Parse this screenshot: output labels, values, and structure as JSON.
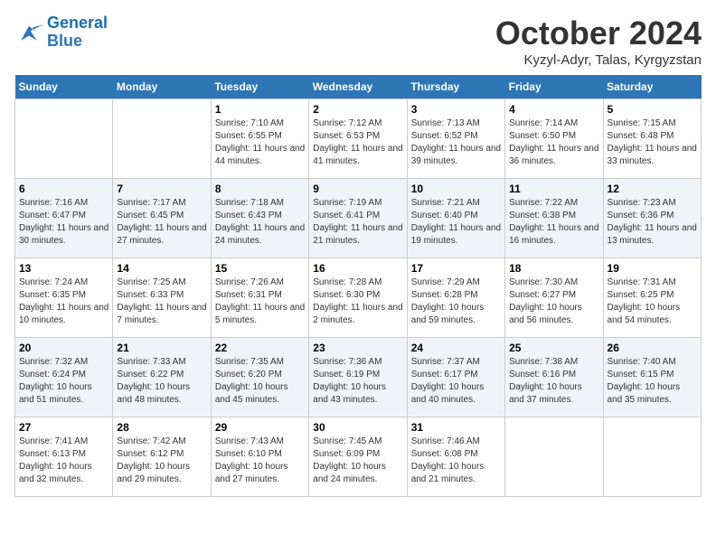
{
  "logo": {
    "line1": "General",
    "line2": "Blue"
  },
  "title": "October 2024",
  "subtitle": "Kyzyl-Adyr, Talas, Kyrgyzstan",
  "weekdays": [
    "Sunday",
    "Monday",
    "Tuesday",
    "Wednesday",
    "Thursday",
    "Friday",
    "Saturday"
  ],
  "weeks": [
    [
      {
        "day": "",
        "info": ""
      },
      {
        "day": "",
        "info": ""
      },
      {
        "day": "1",
        "info": "Sunrise: 7:10 AM\nSunset: 6:55 PM\nDaylight: 11 hours and 44 minutes."
      },
      {
        "day": "2",
        "info": "Sunrise: 7:12 AM\nSunset: 6:53 PM\nDaylight: 11 hours and 41 minutes."
      },
      {
        "day": "3",
        "info": "Sunrise: 7:13 AM\nSunset: 6:52 PM\nDaylight: 11 hours and 39 minutes."
      },
      {
        "day": "4",
        "info": "Sunrise: 7:14 AM\nSunset: 6:50 PM\nDaylight: 11 hours and 36 minutes."
      },
      {
        "day": "5",
        "info": "Sunrise: 7:15 AM\nSunset: 6:48 PM\nDaylight: 11 hours and 33 minutes."
      }
    ],
    [
      {
        "day": "6",
        "info": "Sunrise: 7:16 AM\nSunset: 6:47 PM\nDaylight: 11 hours and 30 minutes."
      },
      {
        "day": "7",
        "info": "Sunrise: 7:17 AM\nSunset: 6:45 PM\nDaylight: 11 hours and 27 minutes."
      },
      {
        "day": "8",
        "info": "Sunrise: 7:18 AM\nSunset: 6:43 PM\nDaylight: 11 hours and 24 minutes."
      },
      {
        "day": "9",
        "info": "Sunrise: 7:19 AM\nSunset: 6:41 PM\nDaylight: 11 hours and 21 minutes."
      },
      {
        "day": "10",
        "info": "Sunrise: 7:21 AM\nSunset: 6:40 PM\nDaylight: 11 hours and 19 minutes."
      },
      {
        "day": "11",
        "info": "Sunrise: 7:22 AM\nSunset: 6:38 PM\nDaylight: 11 hours and 16 minutes."
      },
      {
        "day": "12",
        "info": "Sunrise: 7:23 AM\nSunset: 6:36 PM\nDaylight: 11 hours and 13 minutes."
      }
    ],
    [
      {
        "day": "13",
        "info": "Sunrise: 7:24 AM\nSunset: 6:35 PM\nDaylight: 11 hours and 10 minutes."
      },
      {
        "day": "14",
        "info": "Sunrise: 7:25 AM\nSunset: 6:33 PM\nDaylight: 11 hours and 7 minutes."
      },
      {
        "day": "15",
        "info": "Sunrise: 7:26 AM\nSunset: 6:31 PM\nDaylight: 11 hours and 5 minutes."
      },
      {
        "day": "16",
        "info": "Sunrise: 7:28 AM\nSunset: 6:30 PM\nDaylight: 11 hours and 2 minutes."
      },
      {
        "day": "17",
        "info": "Sunrise: 7:29 AM\nSunset: 6:28 PM\nDaylight: 10 hours and 59 minutes."
      },
      {
        "day": "18",
        "info": "Sunrise: 7:30 AM\nSunset: 6:27 PM\nDaylight: 10 hours and 56 minutes."
      },
      {
        "day": "19",
        "info": "Sunrise: 7:31 AM\nSunset: 6:25 PM\nDaylight: 10 hours and 54 minutes."
      }
    ],
    [
      {
        "day": "20",
        "info": "Sunrise: 7:32 AM\nSunset: 6:24 PM\nDaylight: 10 hours and 51 minutes."
      },
      {
        "day": "21",
        "info": "Sunrise: 7:33 AM\nSunset: 6:22 PM\nDaylight: 10 hours and 48 minutes."
      },
      {
        "day": "22",
        "info": "Sunrise: 7:35 AM\nSunset: 6:20 PM\nDaylight: 10 hours and 45 minutes."
      },
      {
        "day": "23",
        "info": "Sunrise: 7:36 AM\nSunset: 6:19 PM\nDaylight: 10 hours and 43 minutes."
      },
      {
        "day": "24",
        "info": "Sunrise: 7:37 AM\nSunset: 6:17 PM\nDaylight: 10 hours and 40 minutes."
      },
      {
        "day": "25",
        "info": "Sunrise: 7:38 AM\nSunset: 6:16 PM\nDaylight: 10 hours and 37 minutes."
      },
      {
        "day": "26",
        "info": "Sunrise: 7:40 AM\nSunset: 6:15 PM\nDaylight: 10 hours and 35 minutes."
      }
    ],
    [
      {
        "day": "27",
        "info": "Sunrise: 7:41 AM\nSunset: 6:13 PM\nDaylight: 10 hours and 32 minutes."
      },
      {
        "day": "28",
        "info": "Sunrise: 7:42 AM\nSunset: 6:12 PM\nDaylight: 10 hours and 29 minutes."
      },
      {
        "day": "29",
        "info": "Sunrise: 7:43 AM\nSunset: 6:10 PM\nDaylight: 10 hours and 27 minutes."
      },
      {
        "day": "30",
        "info": "Sunrise: 7:45 AM\nSunset: 6:09 PM\nDaylight: 10 hours and 24 minutes."
      },
      {
        "day": "31",
        "info": "Sunrise: 7:46 AM\nSunset: 6:08 PM\nDaylight: 10 hours and 21 minutes."
      },
      {
        "day": "",
        "info": ""
      },
      {
        "day": "",
        "info": ""
      }
    ]
  ]
}
